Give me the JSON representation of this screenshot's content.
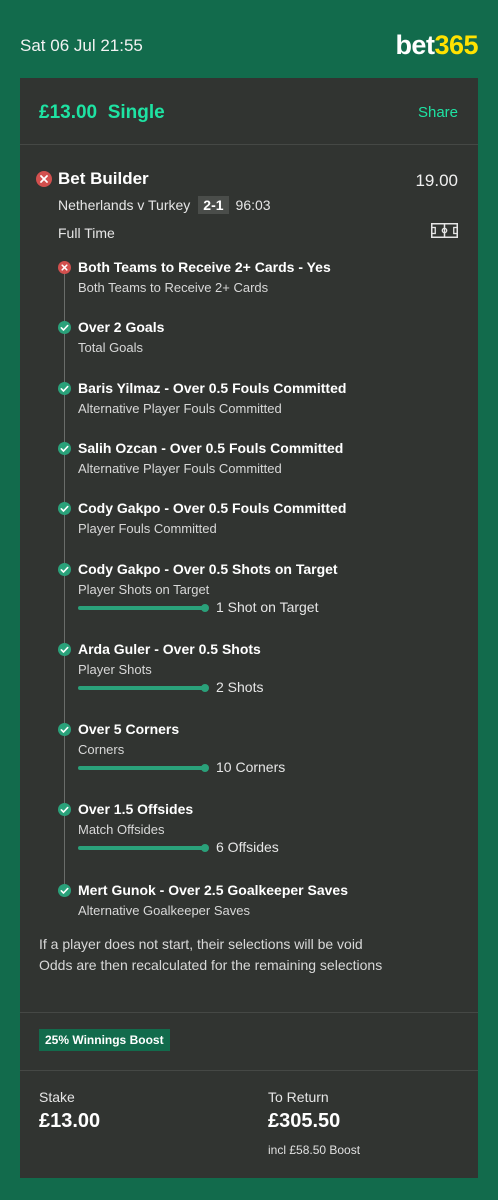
{
  "header": {
    "datetime": "Sat 06 Jul 21:55",
    "logo_part1": "bet",
    "logo_part2": "365"
  },
  "bet": {
    "amount": "£13.00",
    "type": "Single",
    "share_label": "Share",
    "title": "Bet Builder",
    "odds": "19.00",
    "match": "Netherlands v Turkey",
    "score": "2-1",
    "clock": "96:03",
    "status": "Full Time",
    "result_icon": "cross-circle-icon",
    "pitch_icon": "pitch-icon"
  },
  "selections": [
    {
      "title": "Both Teams to Receive 2+ Cards - Yes",
      "market": "Both Teams to Receive 2+ Cards",
      "result": "loss"
    },
    {
      "title": "Over 2 Goals",
      "market": "Total Goals",
      "result": "win"
    },
    {
      "title": "Baris Yilmaz - Over 0.5 Fouls Committed",
      "market": "Alternative Player Fouls Committed",
      "result": "win"
    },
    {
      "title": "Salih Ozcan - Over 0.5 Fouls Committed",
      "market": "Alternative Player Fouls Committed",
      "result": "win"
    },
    {
      "title": "Cody Gakpo - Over 0.5 Fouls Committed",
      "market": "Player Fouls Committed",
      "result": "win"
    },
    {
      "title": "Cody Gakpo - Over 0.5 Shots on Target",
      "market": "Player Shots on Target",
      "result": "win",
      "progress": "1 Shot on Target",
      "progress_complete": 1.0
    },
    {
      "title": "Arda Guler - Over 0.5 Shots",
      "market": "Player Shots",
      "result": "win",
      "progress": "2 Shots",
      "progress_complete": 1.0
    },
    {
      "title": "Over 5 Corners",
      "market": "Corners",
      "result": "win",
      "progress": "10 Corners",
      "progress_complete": 1.0
    },
    {
      "title": "Over 1.5 Offsides",
      "market": "Match Offsides",
      "result": "win",
      "progress": "6 Offsides",
      "progress_complete": 1.0
    },
    {
      "title": "Mert Gunok - Over 2.5 Goalkeeper Saves",
      "market": "Alternative Goalkeeper Saves",
      "result": "win"
    }
  ],
  "notes": {
    "line1": "If a player does not start, their selections will be void",
    "line2": "Odds are then recalculated for the remaining selections"
  },
  "boost": {
    "badge": "25% Winnings Boost"
  },
  "footer": {
    "stake_label": "Stake",
    "stake_value": "£13.00",
    "return_label": "To Return",
    "return_value": "£305.50",
    "boost_note": "incl £58.50 Boost"
  },
  "colors": {
    "page_bg": "#126b4c",
    "card_bg": "#313431",
    "accent": "#1ee3a3",
    "win": "#2aa17a",
    "loss": "#d2504e",
    "logo_365": "#ffe200"
  }
}
